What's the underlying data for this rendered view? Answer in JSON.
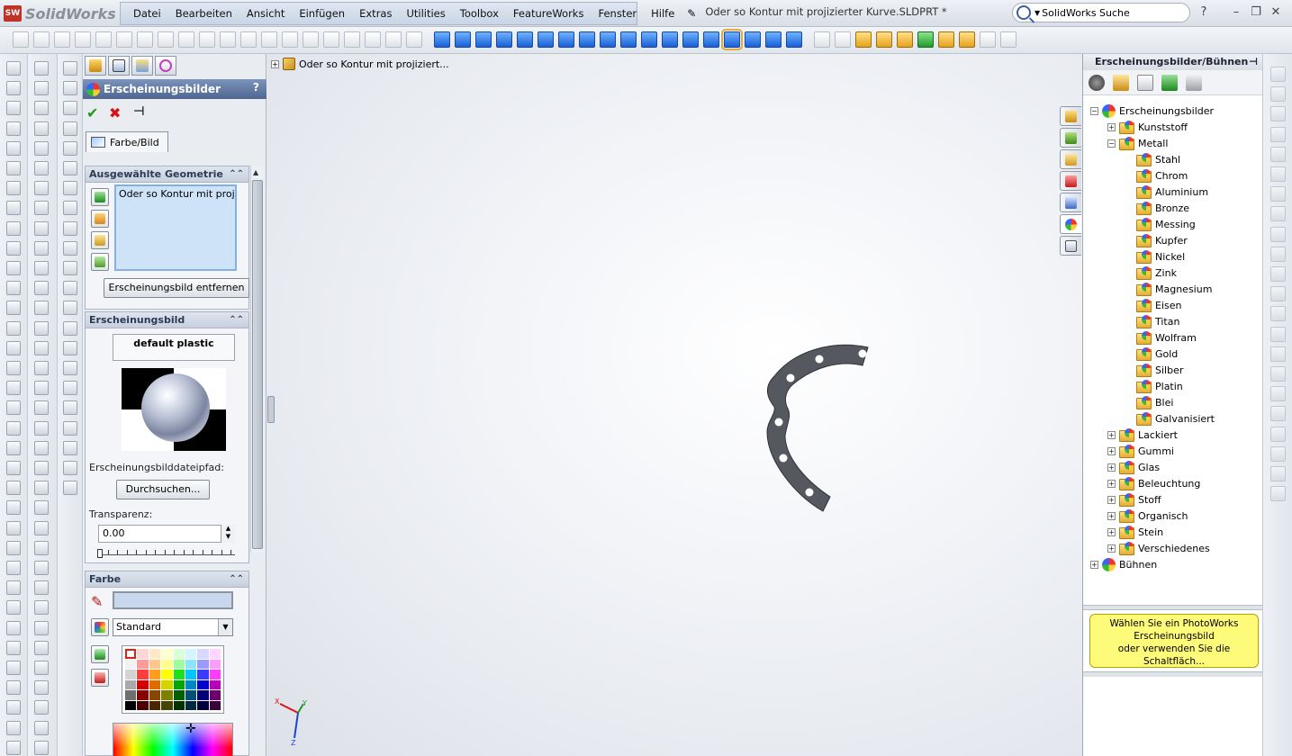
{
  "app": {
    "brand": "SolidWorks",
    "brand_badge": "SW",
    "doc_title": "Oder so Kontur mit projizierter Kurve.SLDPRT *"
  },
  "menu": [
    "Datei",
    "Bearbeiten",
    "Ansicht",
    "Einfügen",
    "Extras",
    "Utilities",
    "Toolbox",
    "FeatureWorks",
    "Fenster",
    "Hilfe"
  ],
  "search": {
    "value": "SolidWorks Suche"
  },
  "window_controls": {
    "help": "?",
    "minimize": "–",
    "restore": "❐",
    "close": "✕"
  },
  "property_manager": {
    "title": "Erscheinungsbilder",
    "help": "?",
    "ok": "✔",
    "cancel": "✖",
    "pin": "⊣",
    "tab_label": "Farbe/Bild",
    "geometry": {
      "header": "Ausgewählte Geometrie",
      "selection": "Oder so Kontur mit projiz",
      "remove_button": "Erscheinungsbild entfernen"
    },
    "appearance": {
      "header": "Erscheinungsbild",
      "name": "default plastic",
      "path_label": "Erscheinungsbilddateipfad:",
      "browse_button": "Durchsuchen...",
      "transparency_label": "Transparenz:",
      "transparency_value": "0.00"
    },
    "color": {
      "header": "Farbe",
      "dropdown_value": "Standard"
    }
  },
  "palette": [
    "#ffffff",
    "#ffd6d6",
    "#ffe9c9",
    "#ffffd0",
    "#d8ffd8",
    "#d4f4ff",
    "#d8d8ff",
    "#ffd6ff",
    "#f2f2f2",
    "#ff9a9a",
    "#ffc78a",
    "#ffff8a",
    "#9aff9a",
    "#8ae6ff",
    "#9a9aff",
    "#ff9aff",
    "#d4d4d4",
    "#ff3b3b",
    "#ff9d1f",
    "#ffff00",
    "#1fe01f",
    "#00c6ff",
    "#3b3bff",
    "#ff3bff",
    "#a9a9a9",
    "#d40000",
    "#e06b00",
    "#d4d400",
    "#00a800",
    "#0088c4",
    "#0000c9",
    "#b800b8",
    "#6f6f6f",
    "#8a0000",
    "#8a4600",
    "#7f7f00",
    "#006100",
    "#005079",
    "#000078",
    "#6e006e",
    "#000000",
    "#4a0000",
    "#4a2600",
    "#454500",
    "#003300",
    "#002a40",
    "#000040",
    "#3b003b"
  ],
  "feature_tree": {
    "expand": "+",
    "item": "Oder so Kontur mit projiziert..."
  },
  "task_pane": {
    "title": "Erscheinungsbilder/Bühnen",
    "pin": "⊣",
    "tree": [
      {
        "label": "Erscheinungsbilder",
        "level": 0,
        "exp": "−",
        "icon": "globe"
      },
      {
        "label": "Kunststoff",
        "level": 1,
        "exp": "+",
        "icon": "folder"
      },
      {
        "label": "Metall",
        "level": 1,
        "exp": "−",
        "icon": "folder"
      },
      {
        "label": "Stahl",
        "level": 2,
        "exp": "",
        "icon": "folder"
      },
      {
        "label": "Chrom",
        "level": 2,
        "exp": "",
        "icon": "folder"
      },
      {
        "label": "Aluminium",
        "level": 2,
        "exp": "",
        "icon": "folder"
      },
      {
        "label": "Bronze",
        "level": 2,
        "exp": "",
        "icon": "folder"
      },
      {
        "label": "Messing",
        "level": 2,
        "exp": "",
        "icon": "folder"
      },
      {
        "label": "Kupfer",
        "level": 2,
        "exp": "",
        "icon": "folder"
      },
      {
        "label": "Nickel",
        "level": 2,
        "exp": "",
        "icon": "folder"
      },
      {
        "label": "Zink",
        "level": 2,
        "exp": "",
        "icon": "folder"
      },
      {
        "label": "Magnesium",
        "level": 2,
        "exp": "",
        "icon": "folder"
      },
      {
        "label": "Eisen",
        "level": 2,
        "exp": "",
        "icon": "folder"
      },
      {
        "label": "Titan",
        "level": 2,
        "exp": "",
        "icon": "folder"
      },
      {
        "label": "Wolfram",
        "level": 2,
        "exp": "",
        "icon": "folder"
      },
      {
        "label": "Gold",
        "level": 2,
        "exp": "",
        "icon": "folder"
      },
      {
        "label": "Silber",
        "level": 2,
        "exp": "",
        "icon": "folder"
      },
      {
        "label": "Platin",
        "level": 2,
        "exp": "",
        "icon": "folder"
      },
      {
        "label": "Blei",
        "level": 2,
        "exp": "",
        "icon": "folder"
      },
      {
        "label": "Galvanisiert",
        "level": 2,
        "exp": "",
        "icon": "folder"
      },
      {
        "label": "Lackiert",
        "level": 1,
        "exp": "+",
        "icon": "folder"
      },
      {
        "label": "Gummi",
        "level": 1,
        "exp": "+",
        "icon": "folder"
      },
      {
        "label": "Glas",
        "level": 1,
        "exp": "+",
        "icon": "folder"
      },
      {
        "label": "Beleuchtung",
        "level": 1,
        "exp": "+",
        "icon": "folder"
      },
      {
        "label": "Stoff",
        "level": 1,
        "exp": "+",
        "icon": "folder"
      },
      {
        "label": "Organisch",
        "level": 1,
        "exp": "+",
        "icon": "folder"
      },
      {
        "label": "Stein",
        "level": 1,
        "exp": "+",
        "icon": "folder"
      },
      {
        "label": "Verschiedenes",
        "level": 1,
        "exp": "+",
        "icon": "folder"
      },
      {
        "label": "Bühnen",
        "level": 0,
        "exp": "+",
        "icon": "globe"
      }
    ],
    "hint_line1": "Wählen Sie ein PhotoWorks",
    "hint_line2": "Erscheinungsbild",
    "hint_line3": "oder verwenden Sie die Schaltfläch..."
  },
  "triad": {
    "x": "X",
    "y": "Y",
    "z": "Z"
  },
  "colors": {
    "accent": "#4e6690",
    "part": "#55595f",
    "hint_bg": "#fffb7a"
  }
}
